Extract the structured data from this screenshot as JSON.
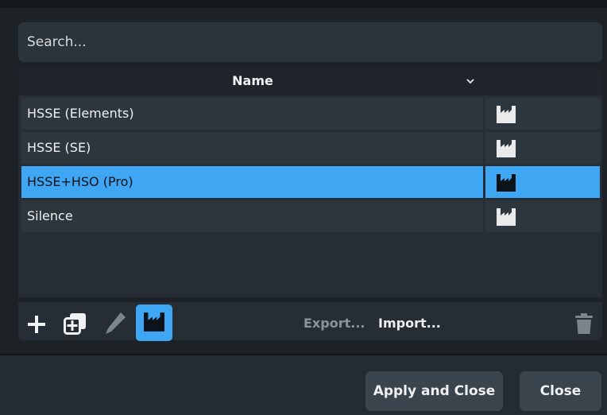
{
  "search": {
    "placeholder": "Search..."
  },
  "table": {
    "header_name": "Name",
    "rows": [
      {
        "name": "HSSE (Elements)",
        "selected": false
      },
      {
        "name": "HSSE (SE)",
        "selected": false
      },
      {
        "name": "HSSE+HSO (Pro)",
        "selected": true
      },
      {
        "name": "Silence",
        "selected": false
      }
    ]
  },
  "toolbar": {
    "export_label": "Export...",
    "import_label": "Import...",
    "icons": [
      "plus-icon",
      "duplicate-icon",
      "pencil-icon",
      "factory-icon",
      "trash-icon"
    ]
  },
  "footer": {
    "apply_label": "Apply and Close",
    "close_label": "Close"
  },
  "colors": {
    "accent": "#3ea6f2",
    "background": "#1d2227",
    "panel": "#262d34",
    "row": "#2e363d"
  }
}
